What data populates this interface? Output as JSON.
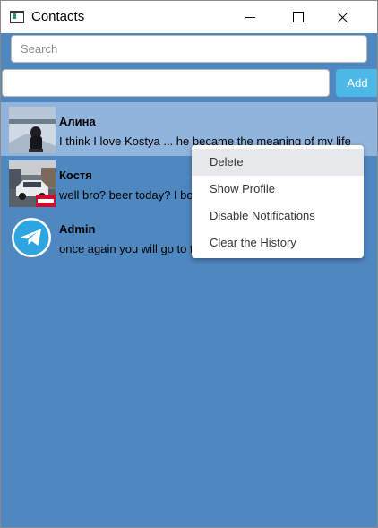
{
  "window": {
    "title": "Contacts"
  },
  "search": {
    "placeholder": "Search"
  },
  "add": {
    "label": "Add",
    "value": ""
  },
  "chats": [
    {
      "name": "Алина",
      "message": "I think I love Kostya ... he became the meaning of my life",
      "avatar": "photo-woman-on-frozen-river",
      "selected": true
    },
    {
      "name": "Костя",
      "message": "well bro? beer today? I bought ten bottles of beer",
      "avatar": "photo-white-car-on-street",
      "selected": false
    },
    {
      "name": "Admin",
      "message": "once again you will go to the school on your own",
      "avatar": "telegram-icon",
      "selected": false
    }
  ],
  "context_menu": {
    "items": [
      {
        "label": "Delete",
        "hovered": true
      },
      {
        "label": "Show Profile"
      },
      {
        "label": "Disable Notifications"
      },
      {
        "label": "Clear the History"
      }
    ]
  },
  "colors": {
    "background": "#4f87c0",
    "selected_row": "#91b4dc",
    "add_button": "#4cb8e8",
    "telegram": "#2ca5e0"
  }
}
